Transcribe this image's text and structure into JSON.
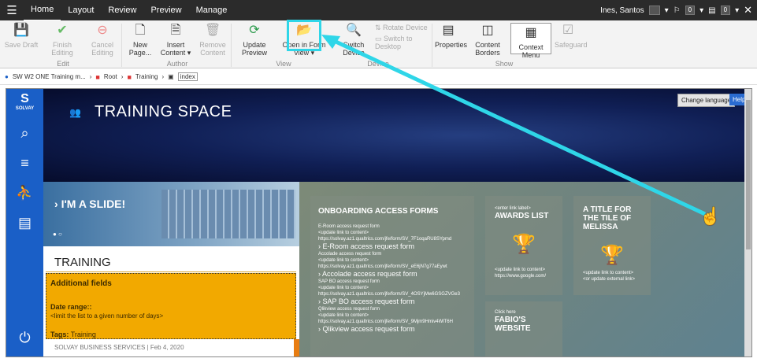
{
  "topbar": {
    "tabs": [
      "Home",
      "Layout",
      "Review",
      "Preview",
      "Manage"
    ],
    "user": "Ines, Santos",
    "count1": "0",
    "count2": "0"
  },
  "ribbon": {
    "buttons": [
      {
        "label": "Save Draft",
        "icon": "save-icon"
      },
      {
        "label": "Finish Editing",
        "icon": "check-icon"
      },
      {
        "label": "Cancel Editing",
        "icon": "cancel-icon"
      },
      {
        "label": "New Page...",
        "icon": "new-page-icon"
      },
      {
        "label": "Insert Content ▾",
        "icon": "insert-content-icon"
      },
      {
        "label": "Remove Content",
        "icon": "trash-icon"
      },
      {
        "label": "Update Preview",
        "icon": "refresh-icon"
      },
      {
        "label": "Open in Form View ▾",
        "icon": "folder-open-icon"
      },
      {
        "label": "Switch Device",
        "icon": "device-icon"
      },
      {
        "label": "Rotate Device",
        "icon": "rotate-icon"
      },
      {
        "label": "Switch to Desktop",
        "icon": "desktop-icon"
      },
      {
        "label": "Properties",
        "icon": "properties-icon"
      },
      {
        "label": "Content Borders",
        "icon": "borders-icon"
      },
      {
        "label": "Context Menu",
        "icon": "context-menu-icon"
      },
      {
        "label": "Safeguard",
        "icon": "safeguard-icon"
      }
    ],
    "groups": [
      "Edit",
      "Author",
      "View",
      "Device",
      "Show"
    ]
  },
  "breadcrumbs": [
    "SW W2 ONE Training m...",
    "Root",
    "Training",
    "index"
  ],
  "page": {
    "hero_title": "TRAINING SPACE",
    "change_language": "Change language",
    "help": "Help",
    "slide_label": "I'M A SLIDE!",
    "training_title": "TRAINING",
    "additional_fields": "Additional fields",
    "date_range": "Date range::",
    "date_range_desc": "<limit the list to a given number of days>",
    "tags_label": "Tags:",
    "tags_value": "Training",
    "footer": "SOLVAY BUSINESS SERVICES  |  Feb 4, 2020",
    "onboarding": {
      "title": "ONBOARDING ACCESS FORMS",
      "items": [
        {
          "small": "E-Room access request form",
          "upd": "<update link to content>",
          "url": "https://solvay.az1.qualtrics.com/jfe/form/SV_7F1oqaRU8SYpmd",
          "name": "E-Room access request form"
        },
        {
          "small": "Accolade access request form",
          "upd": "<update link to content>",
          "url": "https://solvay.az1.qualtrics.com/jfe/form/SV_eE6jN7g77aEywt",
          "name": "Accolade access request form"
        },
        {
          "small": "SAP BO access request form",
          "upd": "<update link to content>",
          "url": "https://solvay.az1.qualtrics.com/jfe/form/SV_4OSYjMw6GSGZVGe3",
          "name": "SAP BO access request form"
        },
        {
          "small": "Qlikview access request form",
          "upd": "<update link to content>",
          "url": "https://solvay.az1.qualtrics.com/jfe/form/SV_9Mjm9Hmiv4WlT6H",
          "name": "Qlikview access request form"
        }
      ]
    },
    "awards": {
      "enter": "<enter link label>",
      "title": "AWARDS LIST",
      "upd": "<update link to content>",
      "url": "https://www.google.com/"
    },
    "titlecard": {
      "title": "A TITLE FOR THE TILE OF MELISSA",
      "upd": "<update link to content>",
      "ext": "<or update external link>"
    },
    "fabio": {
      "click": "Click here",
      "title": "FABIO'S WEBSITE"
    }
  },
  "colors": {
    "accent": "#2fd6e8",
    "nav": "#1a5fc7",
    "yellow": "#f2a900"
  }
}
